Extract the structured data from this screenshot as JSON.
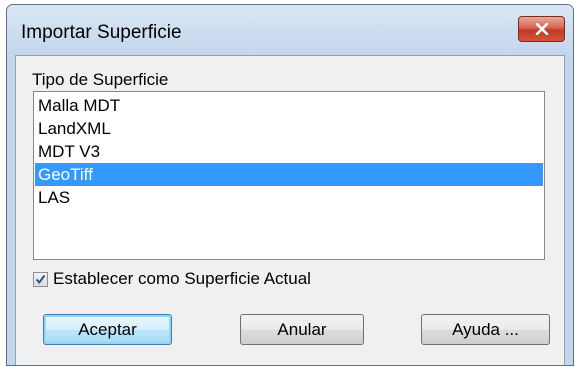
{
  "window": {
    "title": "Importar Superficie"
  },
  "surface_type": {
    "label": "Tipo de Superficie",
    "items": [
      "Malla MDT",
      "LandXML",
      "MDT V3",
      "GeoTiff",
      "LAS"
    ],
    "selected": "GeoTiff"
  },
  "set_current": {
    "label": "Establecer como Superficie Actual",
    "checked": true
  },
  "buttons": {
    "ok": "Aceptar",
    "cancel": "Anular",
    "help": "Ayuda ..."
  },
  "colors": {
    "selection": "#3399ff",
    "close_button": "#c1392a"
  }
}
